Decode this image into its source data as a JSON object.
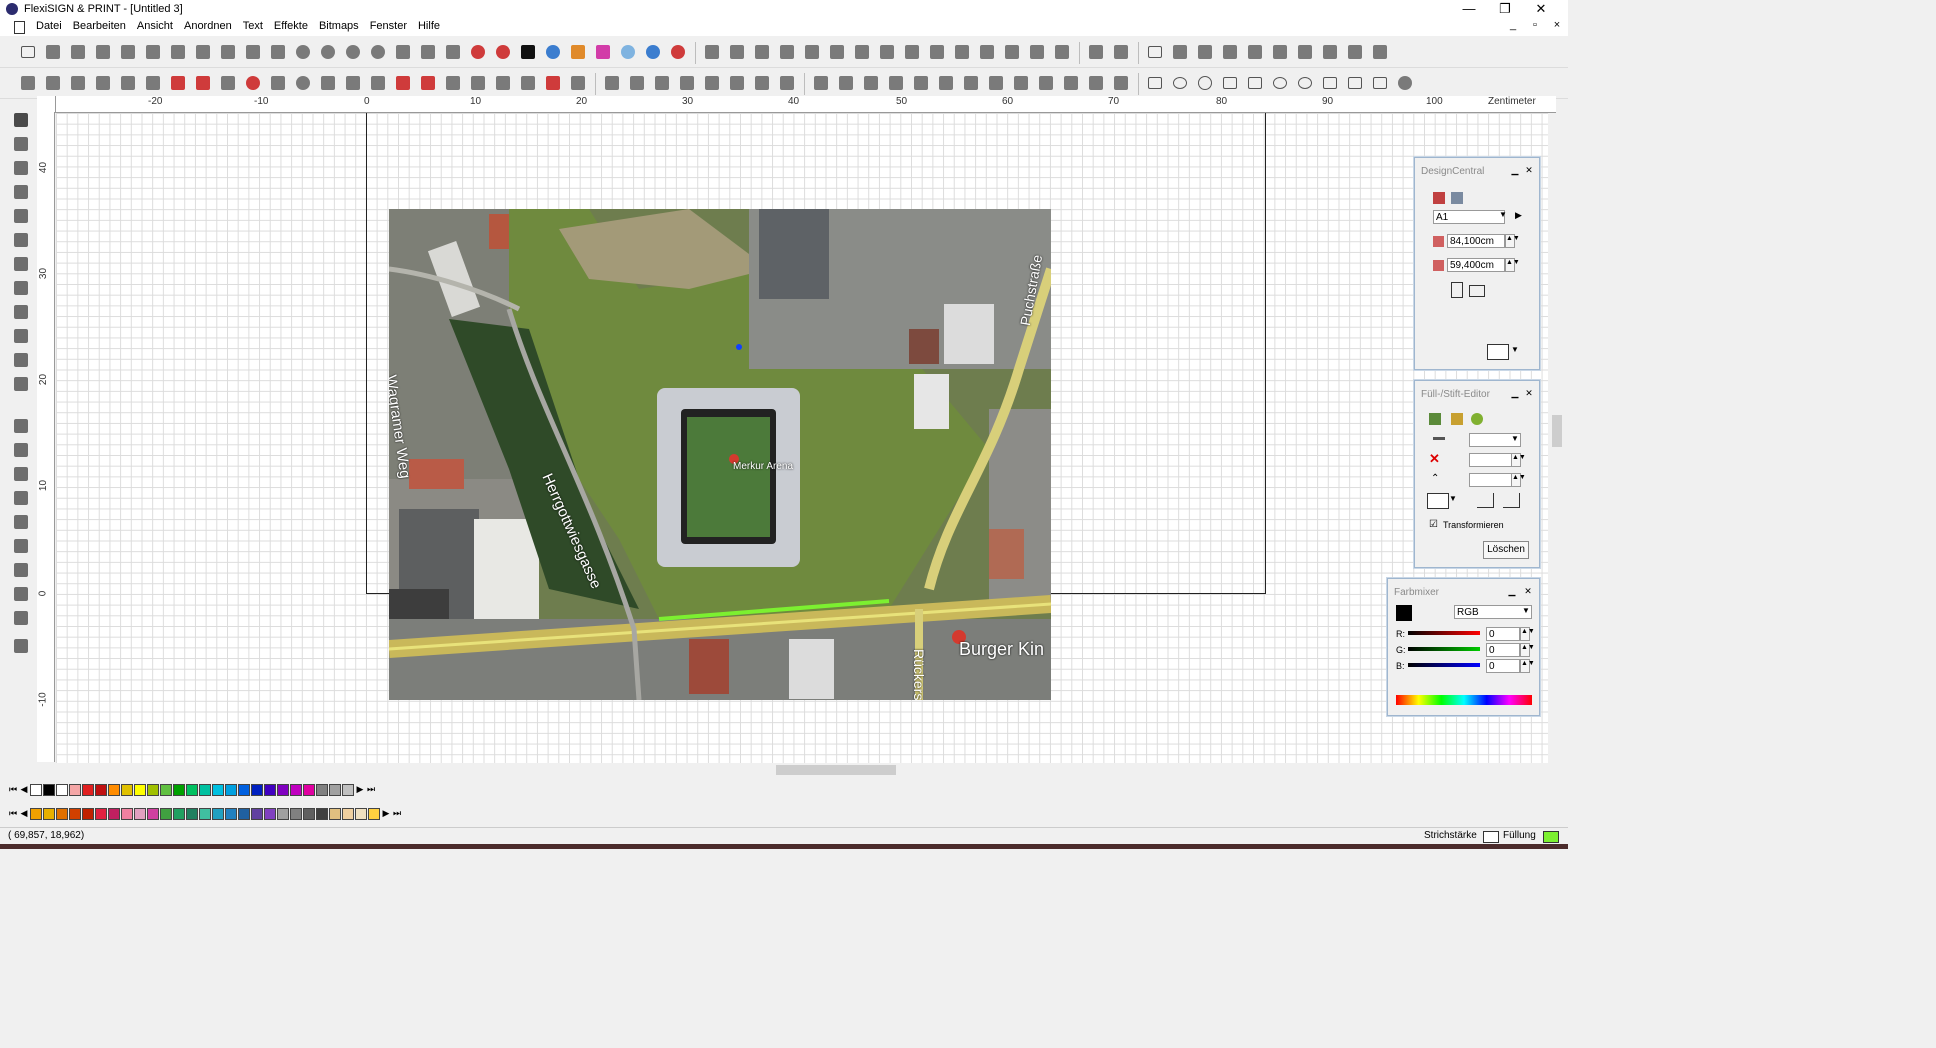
{
  "window": {
    "title": "FlexiSIGN & PRINT - [Untitled 3]",
    "controls": {
      "minimize": "—",
      "maximize": "❐",
      "close": "✕"
    }
  },
  "menubar": {
    "items": [
      "Datei",
      "Bearbeiten",
      "Ansicht",
      "Anordnen",
      "Text",
      "Effekte",
      "Bitmaps",
      "Fenster",
      "Hilfe"
    ],
    "mdi_controls": [
      "_",
      "▫",
      "×"
    ]
  },
  "ruler": {
    "top_labels": [
      "-20",
      "-10",
      "0",
      "10",
      "20",
      "30",
      "40",
      "50",
      "60",
      "70",
      "80",
      "90",
      "100"
    ],
    "unit": "Zentimeter",
    "left_labels": [
      "40",
      "30",
      "20",
      "10",
      "0",
      "-10"
    ]
  },
  "map": {
    "labels": {
      "wagramer": "Wagramer Weg",
      "herrgott": "Herrgottwiesgasse",
      "merkur": "Merkur Arena",
      "puchstr": "Puchstraße",
      "burger": "Burger Kin",
      "ruckers": "Rückers"
    }
  },
  "design_central": {
    "title": "DesignCentral",
    "preset": "A1",
    "width": "84,100cm",
    "height": "59,400cm"
  },
  "fill_editor": {
    "title": "Füll-/Stift-Editor",
    "transform_label": "Transformieren",
    "transform_checked": true,
    "delete_button": "Löschen"
  },
  "color_mixer": {
    "title": "Farbmixer",
    "model": "RGB",
    "r_label": "R:",
    "g_label": "G:",
    "b_label": "B:",
    "r": "0",
    "g": "0",
    "b": "0"
  },
  "palette": {
    "row1": [
      "#000000",
      "#ffffff",
      "#f4a6a6",
      "#e02020",
      "#c01010",
      "#ff8c00",
      "#e0c000",
      "#ffff00",
      "#a0c000",
      "#60c040",
      "#00a000",
      "#00c060",
      "#00c0a0",
      "#00c0e0",
      "#00a0e0",
      "#0060e0",
      "#0020c0",
      "#4000c0",
      "#8000c0",
      "#c000c0",
      "#e000a0",
      "#808080",
      "#a0a0a0",
      "#c0c0c0"
    ],
    "row2": [
      "#f0a000",
      "#e8b000",
      "#e07000",
      "#d04000",
      "#c02000",
      "#e02040",
      "#c02060",
      "#f080a0",
      "#e0a0c0",
      "#d040a0",
      "#40a040",
      "#20a060",
      "#208060",
      "#40c0a0",
      "#20a0c0",
      "#2080c0",
      "#2060a0",
      "#6040a0",
      "#8040c0",
      "#a0a0a0",
      "#808080",
      "#606060",
      "#404040",
      "#e0c080",
      "#f0d0a0",
      "#f0e0c0",
      "#ffd040"
    ]
  },
  "status": {
    "coords": "(  69,857,    18,962)",
    "stroke_label": "Strichstärke",
    "fill_label": "Füllung"
  }
}
